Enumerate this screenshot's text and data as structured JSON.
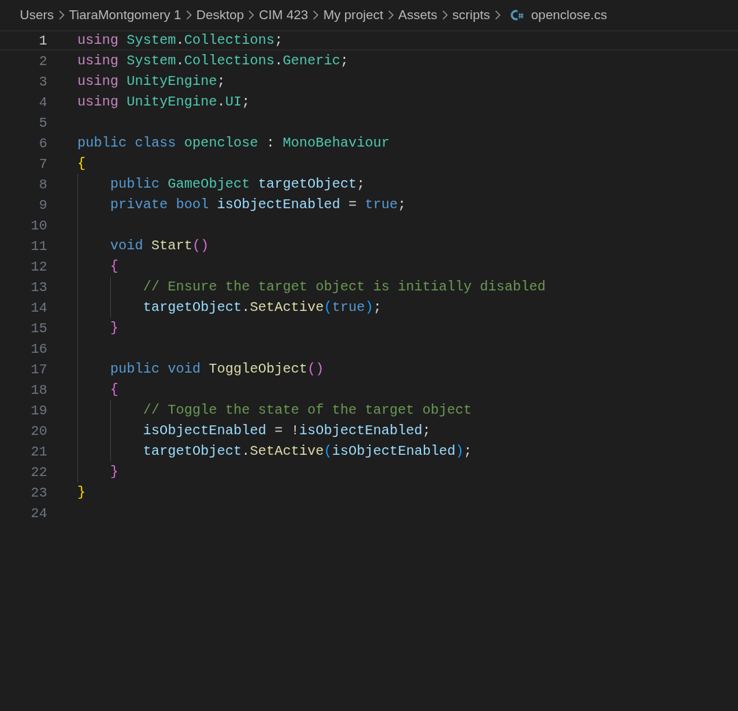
{
  "breadcrumb": [
    {
      "label": "Users",
      "kind": "folder"
    },
    {
      "label": "TiaraMontgomery 1",
      "kind": "folder"
    },
    {
      "label": "Desktop",
      "kind": "folder"
    },
    {
      "label": "CIM 423",
      "kind": "folder"
    },
    {
      "label": "My project",
      "kind": "folder"
    },
    {
      "label": "Assets",
      "kind": "folder"
    },
    {
      "label": "scripts",
      "kind": "folder"
    },
    {
      "label": "openclose.cs",
      "kind": "csharp"
    }
  ],
  "lines": [
    {
      "number": "1",
      "current": true,
      "tokens": [
        {
          "text": "using",
          "kind": "control"
        },
        {
          "text": " System",
          "kind": "type"
        },
        {
          "text": ".",
          "kind": "plain"
        },
        {
          "text": "Collections",
          "kind": "type"
        },
        {
          "text": ";",
          "kind": "plain"
        }
      ]
    },
    {
      "number": "2",
      "current": false,
      "tokens": [
        {
          "text": "using",
          "kind": "control"
        },
        {
          "text": " System",
          "kind": "type"
        },
        {
          "text": ".",
          "kind": "plain"
        },
        {
          "text": "Collections",
          "kind": "type"
        },
        {
          "text": ".",
          "kind": "plain"
        },
        {
          "text": "Generic",
          "kind": "type"
        },
        {
          "text": ";",
          "kind": "plain"
        }
      ]
    },
    {
      "number": "3",
      "current": false,
      "tokens": [
        {
          "text": "using",
          "kind": "control"
        },
        {
          "text": " UnityEngine",
          "kind": "type"
        },
        {
          "text": ";",
          "kind": "plain"
        }
      ]
    },
    {
      "number": "4",
      "current": false,
      "tokens": [
        {
          "text": "using",
          "kind": "control"
        },
        {
          "text": " UnityEngine",
          "kind": "type"
        },
        {
          "text": ".",
          "kind": "plain"
        },
        {
          "text": "UI",
          "kind": "type"
        },
        {
          "text": ";",
          "kind": "plain"
        }
      ]
    },
    {
      "number": "5",
      "current": false
    },
    {
      "number": "6",
      "current": false,
      "tokens": [
        {
          "text": "public class",
          "kind": "keyword"
        },
        {
          "text": " openclose",
          "kind": "type"
        },
        {
          "text": " : ",
          "kind": "plain"
        },
        {
          "text": "MonoBehaviour",
          "kind": "type"
        }
      ]
    },
    {
      "number": "7",
      "current": false,
      "tokens": [
        {
          "text": "{",
          "kind": "bracket1"
        }
      ]
    },
    {
      "number": "8",
      "current": false,
      "tokens": [
        {
          "text": "    public",
          "kind": "keyword"
        },
        {
          "text": " GameObject",
          "kind": "type"
        },
        {
          "text": " targetObject",
          "kind": "variable"
        },
        {
          "text": ";",
          "kind": "plain"
        }
      ]
    },
    {
      "number": "9",
      "current": false,
      "tokens": [
        {
          "text": "    private bool",
          "kind": "keyword"
        },
        {
          "text": " isObjectEnabled",
          "kind": "variable"
        },
        {
          "text": " = ",
          "kind": "plain"
        },
        {
          "text": "true",
          "kind": "keyword"
        },
        {
          "text": ";",
          "kind": "plain"
        }
      ]
    },
    {
      "number": "10",
      "current": false
    },
    {
      "number": "11",
      "current": false,
      "tokens": [
        {
          "text": "    void",
          "kind": "keyword"
        },
        {
          "text": " Start",
          "kind": "function"
        },
        {
          "text": "()",
          "kind": "bracket2"
        }
      ]
    },
    {
      "number": "12",
      "current": false,
      "tokens": [
        {
          "text": "    {",
          "kind": "bracket2"
        }
      ]
    },
    {
      "number": "13",
      "current": false,
      "tokens": [
        {
          "text": "        // Ensure the target object is initially disabled",
          "kind": "comment"
        }
      ]
    },
    {
      "number": "14",
      "current": false,
      "tokens": [
        {
          "text": "        targetObject",
          "kind": "variable"
        },
        {
          "text": ".",
          "kind": "plain"
        },
        {
          "text": "SetActive",
          "kind": "function"
        },
        {
          "text": "(",
          "kind": "bracket3"
        },
        {
          "text": "true",
          "kind": "keyword"
        },
        {
          "text": ")",
          "kind": "bracket3"
        },
        {
          "text": ";",
          "kind": "plain"
        }
      ]
    },
    {
      "number": "15",
      "current": false,
      "tokens": [
        {
          "text": "    }",
          "kind": "bracket2"
        }
      ]
    },
    {
      "number": "16",
      "current": false
    },
    {
      "number": "17",
      "current": false,
      "tokens": [
        {
          "text": "    public void",
          "kind": "keyword"
        },
        {
          "text": " ToggleObject",
          "kind": "function"
        },
        {
          "text": "()",
          "kind": "bracket2"
        }
      ]
    },
    {
      "number": "18",
      "current": false,
      "tokens": [
        {
          "text": "    {",
          "kind": "bracket2"
        }
      ]
    },
    {
      "number": "19",
      "current": false,
      "tokens": [
        {
          "text": "        // Toggle the state of the target object",
          "kind": "comment"
        }
      ]
    },
    {
      "number": "20",
      "current": false,
      "tokens": [
        {
          "text": "        isObjectEnabled",
          "kind": "variable"
        },
        {
          "text": " = !",
          "kind": "plain"
        },
        {
          "text": "isObjectEnabled",
          "kind": "variable"
        },
        {
          "text": ";",
          "kind": "plain"
        }
      ]
    },
    {
      "number": "21",
      "current": false,
      "tokens": [
        {
          "text": "        targetObject",
          "kind": "variable"
        },
        {
          "text": ".",
          "kind": "plain"
        },
        {
          "text": "SetActive",
          "kind": "function"
        },
        {
          "text": "(",
          "kind": "bracket3"
        },
        {
          "text": "isObjectEnabled",
          "kind": "variable"
        },
        {
          "text": ")",
          "kind": "bracket3"
        },
        {
          "text": ";",
          "kind": "plain"
        }
      ]
    },
    {
      "number": "22",
      "current": false,
      "tokens": [
        {
          "text": "    }",
          "kind": "bracket2"
        }
      ]
    },
    {
      "number": "23",
      "current": false,
      "tokens": [
        {
          "text": "}",
          "kind": "bracket1"
        }
      ]
    },
    {
      "number": "24",
      "current": false
    }
  ]
}
